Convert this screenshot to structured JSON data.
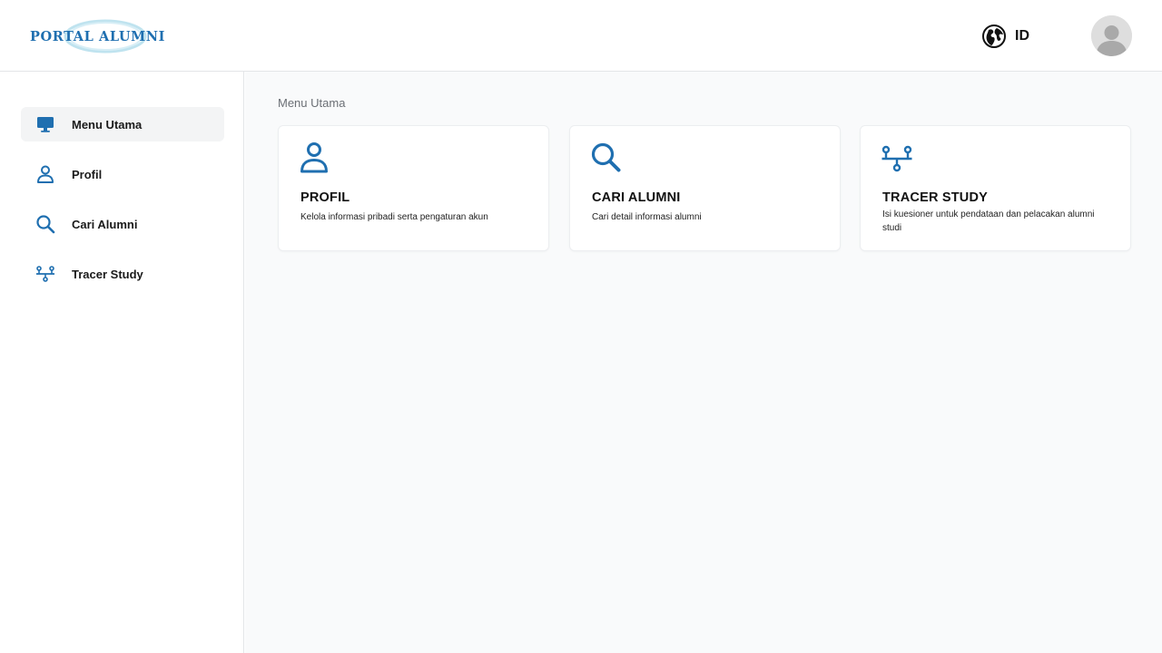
{
  "header": {
    "logo_text": "PORTAL ALUMNI",
    "language": "ID",
    "icons": {
      "language": "globe-icon",
      "avatar": "user-avatar"
    }
  },
  "sidebar": {
    "items": [
      {
        "label": "Menu Utama",
        "icon": "monitor-icon",
        "active": true
      },
      {
        "label": "Profil",
        "icon": "user-icon",
        "active": false
      },
      {
        "label": "Cari Alumni",
        "icon": "search-icon",
        "active": false
      },
      {
        "label": "Tracer Study",
        "icon": "network-icon",
        "active": false
      }
    ]
  },
  "main": {
    "breadcrumb": "Menu Utama",
    "cards": [
      {
        "title": "PROFIL",
        "description": "Kelola informasi pribadi serta pengaturan akun",
        "icon": "user-icon"
      },
      {
        "title": "CARI ALUMNI",
        "description": "Cari detail informasi alumni",
        "icon": "search-icon"
      },
      {
        "title": "TRACER STUDY",
        "description": "Isi kuesioner untuk pendataan dan pelacakan alumni studi",
        "icon": "network-icon"
      }
    ]
  },
  "colors": {
    "accent": "#1f6fb0",
    "main_background": "#f9fafb",
    "active_item_background": "#f3f4f5"
  }
}
